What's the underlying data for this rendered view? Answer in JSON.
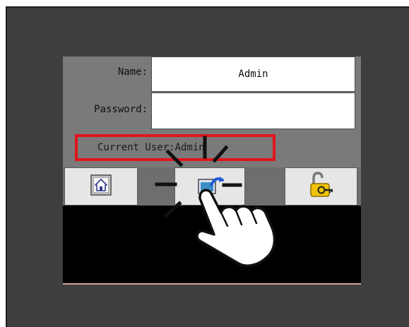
{
  "login": {
    "name_label": "Name:",
    "name_value": "Admin",
    "password_label": "Password:",
    "password_value": "",
    "current_user_text": "Current User:Admin"
  },
  "toolbar": {
    "home_icon": "home-icon",
    "user_switch_icon": "user-switch-icon",
    "logout_icon": "padlock-key-icon"
  },
  "overlay": {
    "hand_icon": "pointing-hand-icon"
  },
  "colors": {
    "bezel": "#3e3e3e",
    "form_background": "#7a7a7a",
    "highlight_frame": "#e3141b",
    "lock_yellow": "#f0c400"
  }
}
